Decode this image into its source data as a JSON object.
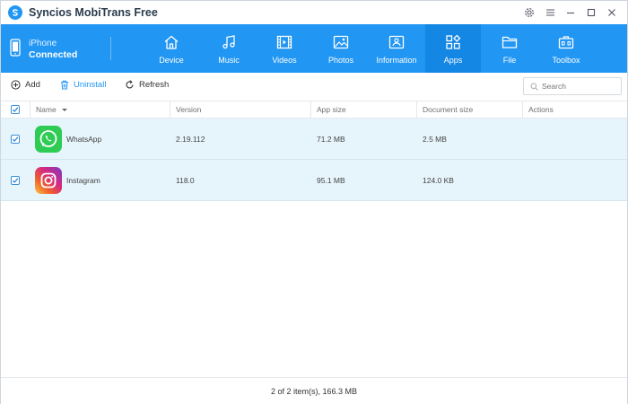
{
  "app": {
    "title": "Syncios MobiTrans Free"
  },
  "device": {
    "name": "iPhone",
    "status": "Connected"
  },
  "nav": {
    "tabs": [
      {
        "label": "Device",
        "icon": "home-icon"
      },
      {
        "label": "Music",
        "icon": "music-note-icon"
      },
      {
        "label": "Videos",
        "icon": "film-icon"
      },
      {
        "label": "Photos",
        "icon": "image-icon"
      },
      {
        "label": "Information",
        "icon": "contact-card-icon"
      },
      {
        "label": "Apps",
        "icon": "apps-grid-icon"
      },
      {
        "label": "File",
        "icon": "folder-icon"
      },
      {
        "label": "Toolbox",
        "icon": "toolbox-icon"
      }
    ],
    "active_tab": "Apps"
  },
  "toolbar": {
    "add_label": "Add",
    "uninstall_label": "Uninstall",
    "refresh_label": "Refresh",
    "search_placeholder": "Search"
  },
  "table": {
    "columns": [
      "Name",
      "Version",
      "App size",
      "Document size",
      "Actions"
    ],
    "rows": [
      {
        "name": "WhatsApp",
        "version": "2.19.112",
        "app_size": "71.2 MB",
        "doc_size": "2.5 MB",
        "checked": true
      },
      {
        "name": "Instagram",
        "version": "118.0",
        "app_size": "95.1 MB",
        "doc_size": "124.0 KB",
        "checked": true
      }
    ]
  },
  "status": {
    "summary": "2 of 2 item(s), 166.3 MB"
  },
  "colors": {
    "accent": "#2196f3",
    "active_tab": "#1486e3",
    "row_selected": "#e6f4fb"
  }
}
